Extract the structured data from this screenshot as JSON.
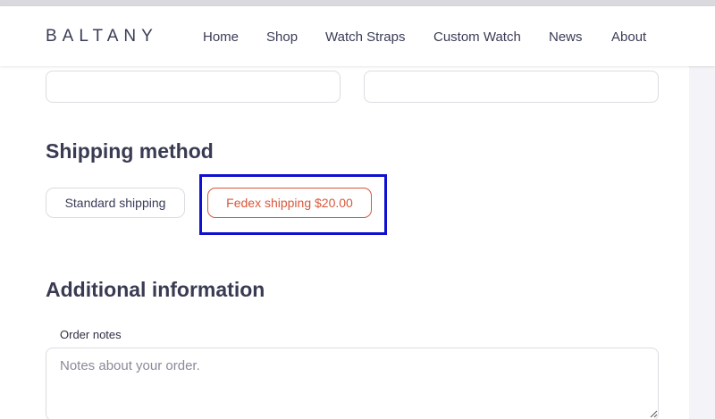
{
  "header": {
    "logo": "BALTANY",
    "nav": [
      {
        "label": "Home"
      },
      {
        "label": "Shop"
      },
      {
        "label": "Watch Straps"
      },
      {
        "label": "Custom Watch"
      },
      {
        "label": "News"
      },
      {
        "label": "About"
      }
    ]
  },
  "shipping": {
    "title": "Shipping method",
    "options": [
      {
        "label": "Standard shipping",
        "selected": false
      },
      {
        "label": "Fedex shipping $20.00",
        "selected": true
      }
    ]
  },
  "additional": {
    "title": "Additional information",
    "order_notes_label": "Order notes",
    "order_notes_placeholder": "Notes about your order.",
    "order_notes_value": ""
  },
  "colors": {
    "accent": "#d9573b",
    "highlight": "#1010d0",
    "text": "#3a3c56"
  }
}
